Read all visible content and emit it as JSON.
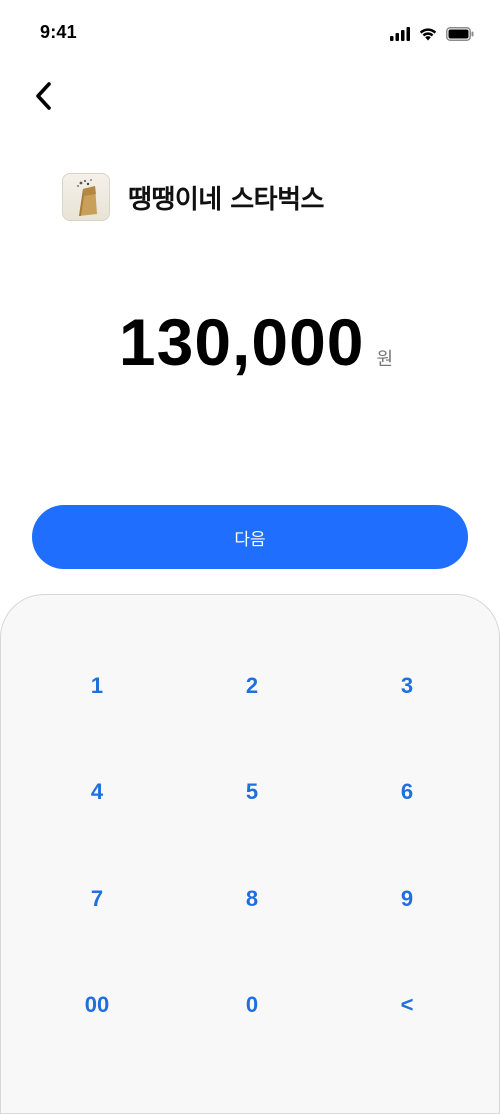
{
  "status_bar": {
    "time": "9:41",
    "icons": [
      "signal-icon",
      "wifi-icon",
      "battery-icon"
    ]
  },
  "header": {
    "back_icon": "chevron-left-icon"
  },
  "account": {
    "avatar_icon": "paper-bag-coffee-icon",
    "name": "땡땡이네 스타벅스"
  },
  "amount": {
    "value": "130,000",
    "unit": "원"
  },
  "next_button": {
    "label": "다음",
    "color": "#1f6efe"
  },
  "keypad": {
    "key_color": "#1f6fdc",
    "keys": [
      "1",
      "2",
      "3",
      "4",
      "5",
      "6",
      "7",
      "8",
      "9",
      "00",
      "0",
      "<"
    ]
  }
}
